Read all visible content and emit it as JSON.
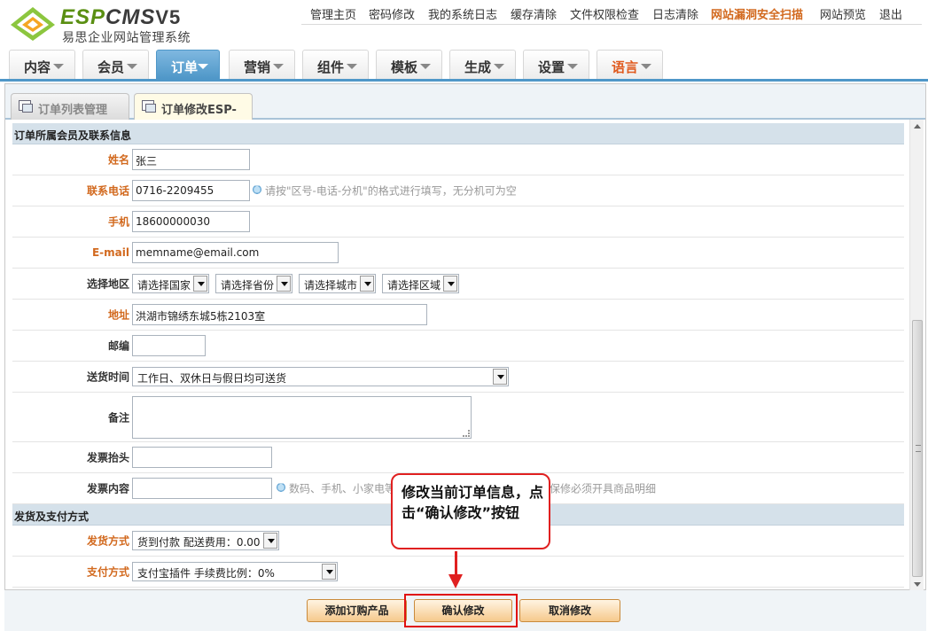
{
  "logo": {
    "brand_esp": "ESP",
    "brand_cms": "CMS",
    "brand_version": "V5",
    "subtitle": "易思企业网站管理系统"
  },
  "topnav": [
    {
      "label": "管理主页",
      "alert": false
    },
    {
      "label": "密码修改",
      "alert": false
    },
    {
      "label": "我的系统日志",
      "alert": false
    },
    {
      "label": "缓存清除",
      "alert": false
    },
    {
      "label": "文件权限检查",
      "alert": false
    },
    {
      "label": "日志清除",
      "alert": false
    },
    {
      "label": "网站漏洞安全扫描",
      "alert": true
    },
    {
      "label": "网站预览",
      "alert": false
    },
    {
      "label": "退出",
      "alert": false
    }
  ],
  "mainmenu": [
    {
      "label": "内容",
      "active": false
    },
    {
      "label": "会员",
      "active": false
    },
    {
      "label": "订单",
      "active": true
    },
    {
      "label": "营销",
      "active": false
    },
    {
      "label": "组件",
      "active": false
    },
    {
      "label": "模板",
      "active": false
    },
    {
      "label": "生成",
      "active": false
    },
    {
      "label": "设置",
      "active": false
    },
    {
      "label": "语言",
      "active": false
    }
  ],
  "tabs": [
    {
      "label": "订单列表管理",
      "active": false
    },
    {
      "label": "订单修改ESP-",
      "active": true
    }
  ],
  "form": {
    "section_member": "订单所属会员及联系信息",
    "name": {
      "label": "姓名",
      "value": "张三"
    },
    "phone": {
      "label": "联系电话",
      "value": "0716-2209455",
      "hint": "请按\"区号-电话-分机\"的格式进行填写，无分机可为空"
    },
    "mobile": {
      "label": "手机",
      "value": "18600000030"
    },
    "email": {
      "label": "E-mail",
      "value": "memname@email.com"
    },
    "region": {
      "label": "选择地区",
      "country": "请选择国家",
      "province": "请选择省份",
      "city": "请选择城市",
      "district": "请选择区域"
    },
    "address": {
      "label": "地址",
      "value": "洪湖市锦绣东城5栋2103室"
    },
    "zipcode": {
      "label": "邮编",
      "value": ""
    },
    "delivery_time": {
      "label": "送货时间",
      "value": "工作日、双休日与假日均可送货"
    },
    "remark": {
      "label": "备注",
      "value": ""
    },
    "invoice_title": {
      "label": "发票抬头",
      "value": ""
    },
    "invoice_content": {
      "label": "发票内容",
      "value": "",
      "hint_a": "数码、手机、小家电等",
      "hint_b": "保修必须开具商品明细"
    },
    "section_shipping": "发货及支付方式",
    "shipping": {
      "label": "发货方式",
      "value": "货到付款 配送费用：0.00"
    },
    "payment": {
      "label": "支付方式",
      "value": "支付宝插件 手续费比例：0%"
    }
  },
  "buttons": {
    "add_product": "添加订购产品",
    "confirm": "确认修改",
    "cancel": "取消修改"
  },
  "callout": {
    "text": "修改当前订单信息，点击“确认修改”按钮"
  }
}
